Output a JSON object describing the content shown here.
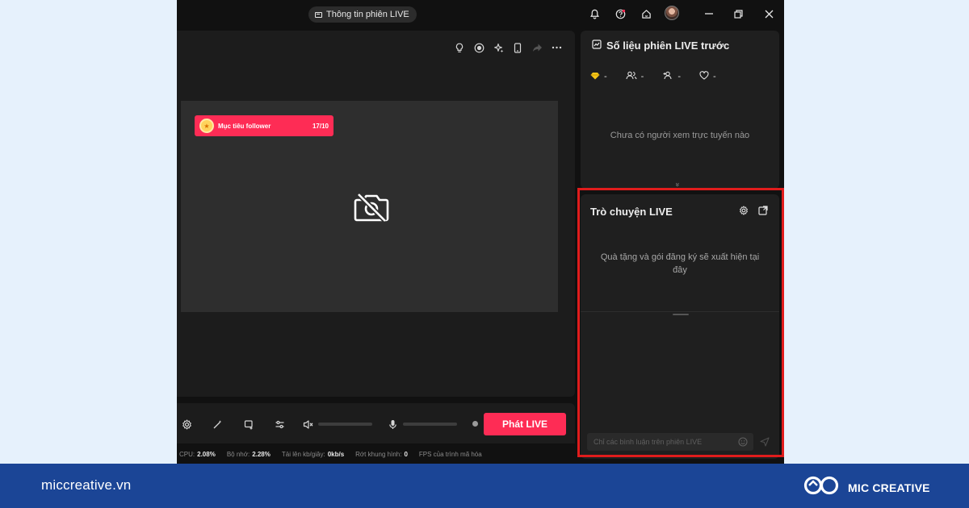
{
  "window": {
    "title": "Thông tin phiên LIVE"
  },
  "preview": {
    "goal_label": "Mục tiêu follower",
    "goal_count": "17/10"
  },
  "controls": {
    "go_live_label": "Phát LIVE"
  },
  "stats": {
    "cpu_label": "CPU:",
    "cpu_value": "2.08%",
    "memory_label": "Bộ nhớ:",
    "memory_value": "2.28%",
    "upload_label": "Tải lên kb/giây:",
    "upload_value": "0kb/s",
    "dropped_label": "Rớt khung hình:",
    "dropped_value": "0",
    "fps_label": "FPS của trình mã hóa"
  },
  "metrics": {
    "title": "Số liệu phiên LIVE trước",
    "items": [
      {
        "icon": "diamond-icon",
        "value": "-"
      },
      {
        "icon": "viewers-icon",
        "value": "-"
      },
      {
        "icon": "new-follower-icon",
        "value": "-"
      },
      {
        "icon": "heart-icon",
        "value": "-"
      }
    ],
    "empty_text": "Chưa có người xem trực tuyến nào",
    "expand_glyph": "»"
  },
  "chat": {
    "title": "Trò chuyện LIVE",
    "gift_notice": "Quà tặng và gói đăng ký sẽ xuất hiện tại đây",
    "input_placeholder": "Chỉ các bình luận trên phiên LIVE"
  },
  "footer": {
    "url": "miccreative.vn",
    "brand": "MIC CREATIVE"
  },
  "colors": {
    "accent": "#fe2c55",
    "highlight": "#e01c1c",
    "footer": "#1b4596",
    "page_background": "#e6f1fc"
  }
}
